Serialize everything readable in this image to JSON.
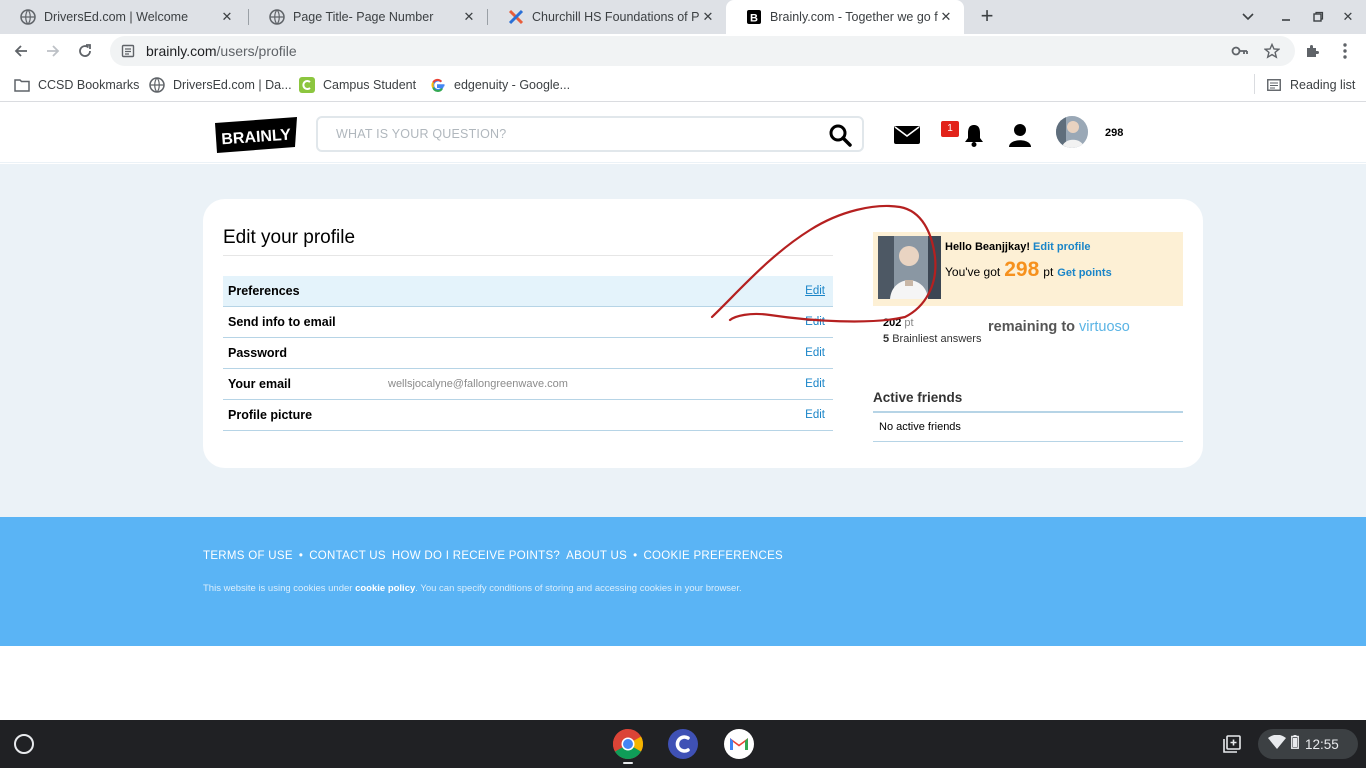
{
  "browser": {
    "tabs": [
      {
        "title": "DriversEd.com | Welcome",
        "favicon": "globe-icon"
      },
      {
        "title": "Page Title- Page Number",
        "favicon": "globe-icon"
      },
      {
        "title": "Churchill HS Foundations of Pers",
        "favicon": "x-logo-icon"
      },
      {
        "title": "Brainly.com - Together we go far",
        "favicon": "brainly-b-icon"
      }
    ],
    "url_domain": "brainly.com",
    "url_path": "/users/profile",
    "bookmarks": [
      {
        "label": "CCSD Bookmarks",
        "icon": "folder-icon"
      },
      {
        "label": "DriversEd.com | Da...",
        "icon": "globe-icon"
      },
      {
        "label": "Campus Student",
        "icon": "campus-icon"
      },
      {
        "label": "edgenuity - Google...",
        "icon": "google-icon"
      }
    ],
    "reading_list": "Reading list"
  },
  "site": {
    "logo": "BRAINLY",
    "search_placeholder": "WHAT IS YOUR QUESTION?",
    "notification_count": "1",
    "header_points": "298"
  },
  "profile": {
    "title": "Edit your profile",
    "rows": [
      {
        "label": "Preferences",
        "value": "",
        "edit": "Edit"
      },
      {
        "label": "Send info to email",
        "value": "",
        "edit": "Edit"
      },
      {
        "label": "Password",
        "value": "",
        "edit": "Edit"
      },
      {
        "label": "Your email",
        "value": "wellsjocalyne@fallongreenwave.com",
        "edit": "Edit"
      },
      {
        "label": "Profile picture",
        "value": "",
        "edit": "Edit"
      }
    ]
  },
  "user": {
    "hello": "Hello Beanjjkay!",
    "edit_profile": "Edit profile",
    "got_prefix": "You've got",
    "points": "298",
    "points_unit": "pt",
    "get_points": "Get points",
    "remaining_points": "202",
    "remaining_unit": "pt",
    "brainliest_count": "5",
    "brainliest_label": "Brainliest answers",
    "remaining_to": "remaining to",
    "next_rank": "virtuoso",
    "active_friends_title": "Active friends",
    "no_friends": "No active friends"
  },
  "footer": {
    "links": [
      "TERMS OF USE",
      "CONTACT US",
      "HOW DO I RECEIVE POINTS?",
      "ABOUT US",
      "COOKIE PREFERENCES"
    ],
    "cookie_prefix": "This website is using cookies under",
    "cookie_link": "cookie policy",
    "cookie_suffix": ". You can specify conditions of storing and accessing cookies in your browser."
  },
  "shelf": {
    "apps": [
      "chrome-icon",
      "classlink-icon",
      "gmail-icon"
    ],
    "time": "12:55"
  },
  "colors": {
    "brand_blue": "#5ab4f5",
    "link_blue": "#1a85c8",
    "points_orange": "#f6911d",
    "scribble_red": "#b52020"
  }
}
